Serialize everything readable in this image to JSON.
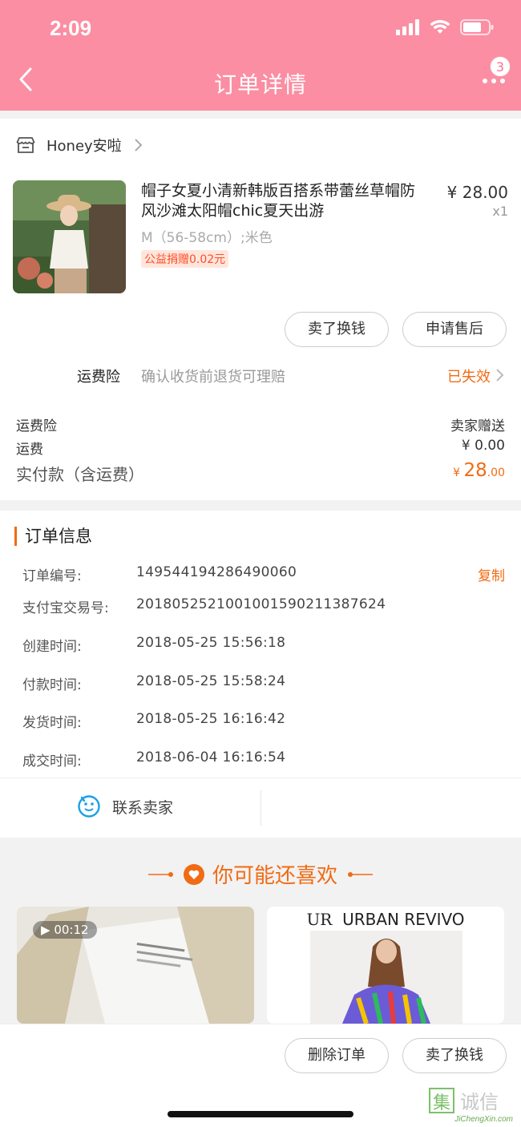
{
  "status": {
    "time": "2:09"
  },
  "header": {
    "title": "订单详情",
    "badge_count": "3"
  },
  "shop": {
    "name": "Honey安啦"
  },
  "product": {
    "title": "帽子女夏小清新韩版百搭系带蕾丝草帽防风沙滩太阳帽chic夏天出游",
    "price": "¥ 28.00",
    "qty": "x1",
    "sku": "M（56-58cm）;米色",
    "charity": "公益捐赠0.02元",
    "sell_btn": "卖了换钱",
    "after_sale_btn": "申请售后"
  },
  "insurance": {
    "label": "运费险",
    "desc": "确认收货前退货可理赔",
    "status": "已失效"
  },
  "fees": {
    "ins_label": "运费险",
    "ins_value": "卖家赠送",
    "ship_label": "运费",
    "ship_value": "¥ 0.00",
    "total_label": "实付款（含运费）",
    "total_currency": "¥ ",
    "total_int": "28",
    "total_dec": ".00"
  },
  "order_info": {
    "title": "订单信息",
    "copy": "复制",
    "rows": [
      {
        "label": "订单编号:",
        "value": "149544194286490060"
      },
      {
        "label": "支付宝交易号:",
        "value": "2018052521001001590211387624"
      },
      {
        "label": "创建时间:",
        "value": "2018-05-25 15:56:18"
      },
      {
        "label": "付款时间:",
        "value": "2018-05-25 15:58:24"
      },
      {
        "label": "发货时间:",
        "value": "2018-05-25 16:16:42"
      },
      {
        "label": "成交时间:",
        "value": "2018-06-04 16:16:54"
      }
    ],
    "contact": "联系卖家"
  },
  "recommend": {
    "title": "你可能还喜欢",
    "video_time": "00:12",
    "brand_logo": "UR",
    "brand": "URBAN REVIVO"
  },
  "bottom": {
    "delete_btn": "删除订单",
    "sell_btn": "卖了换钱"
  },
  "watermark": {
    "logo": "集诚信",
    "url": "JiChengXin.com"
  },
  "colors": {
    "header_bg": "#fb8ea3",
    "accent": "#f16b14"
  }
}
